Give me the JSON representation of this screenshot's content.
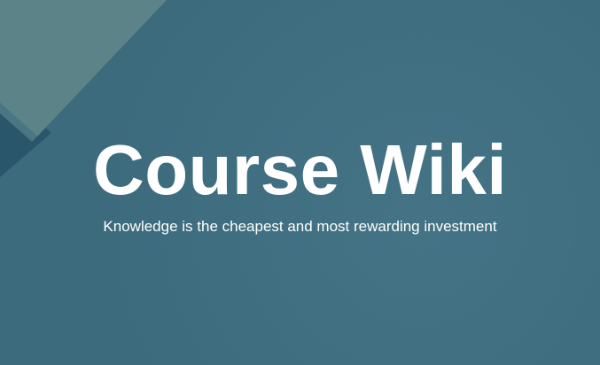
{
  "hero": {
    "title": "Course Wiki",
    "subtitle": "Knowledge is the cheapest and most rewarding investment"
  },
  "colors": {
    "background": "#3e6f82",
    "corner_panel": "#5a8287",
    "corner_shadow": "#274f63",
    "text": "#ffffff"
  }
}
